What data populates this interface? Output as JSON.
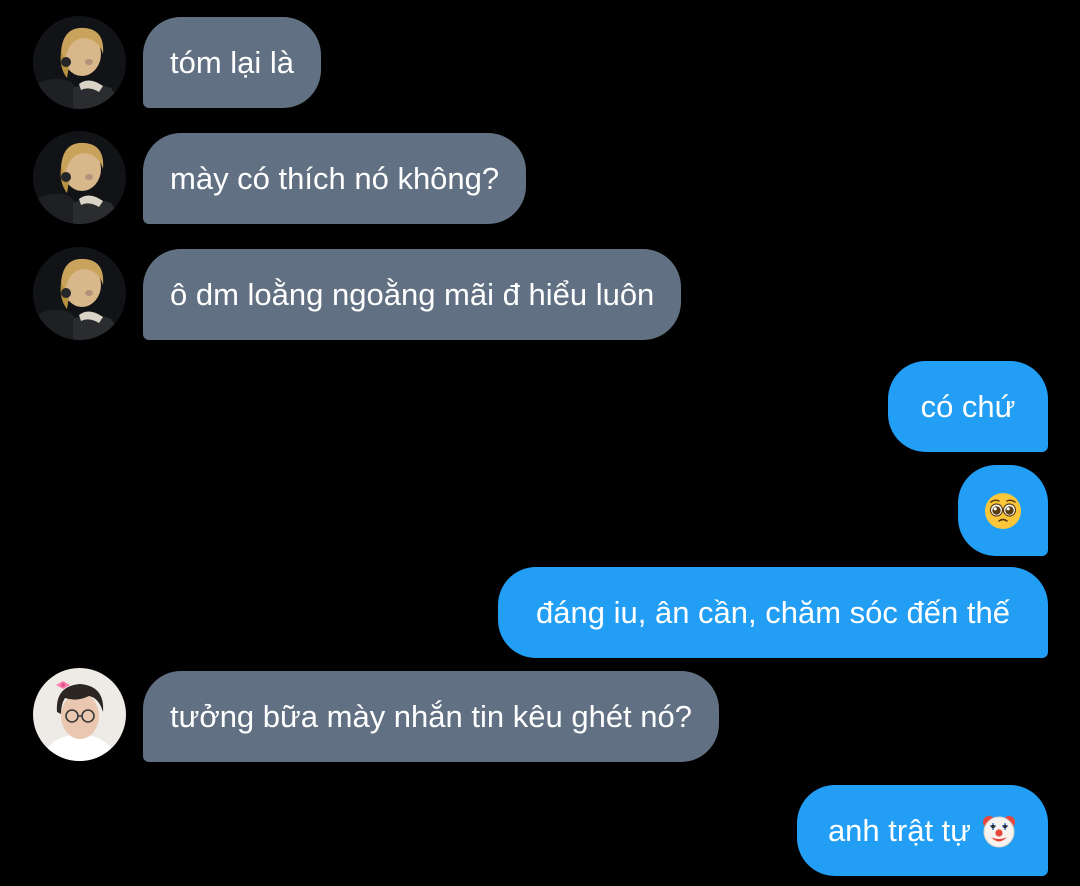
{
  "messages": [
    {
      "side": "incoming",
      "avatar": "contact-a-avatar",
      "text": "tóm lại là"
    },
    {
      "side": "incoming",
      "avatar": "contact-a-avatar",
      "text": "mày có thích nó không?"
    },
    {
      "side": "incoming",
      "avatar": "contact-a-avatar",
      "text": "ô dm loằng ngoằng mãi đ hiểu luôn"
    },
    {
      "side": "outgoing",
      "text": "có chứ"
    },
    {
      "side": "outgoing",
      "text": "",
      "icon": "pleading-face-emoji-icon"
    },
    {
      "side": "outgoing",
      "text": "đáng iu, ân cần, chăm sóc đến thế"
    },
    {
      "side": "incoming",
      "avatar": "contact-b-avatar",
      "text": "tưởng bữa mày nhắn tin kêu ghét nó?"
    },
    {
      "side": "outgoing",
      "text": "anh trật tự",
      "icon": "clown-face-emoji-icon"
    }
  ],
  "colors": {
    "background": "#000000",
    "incoming_bubble": "#617183",
    "outgoing_bubble": "#229ef5",
    "text": "#ffffff"
  }
}
